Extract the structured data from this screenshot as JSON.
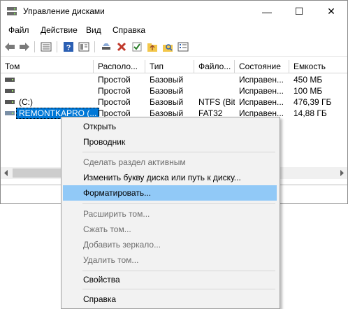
{
  "window": {
    "title": "Управление дисками"
  },
  "window_controls": {
    "minimize": "—",
    "maximize": "☐",
    "close": "✕"
  },
  "menu": [
    "Файл",
    "Действие",
    "Вид",
    "Справка"
  ],
  "toolbar_icons": [
    "back-arrow-icon",
    "forward-arrow-icon",
    "properties-panel-icon",
    "help-icon",
    "details-panel-icon",
    "connect-icon",
    "delete-icon",
    "check-icon",
    "folder-up-icon",
    "search-icon",
    "list-icon"
  ],
  "columns": [
    "Том",
    "Располо...",
    "Тип",
    "Файло...",
    "Состояние",
    "Емкость"
  ],
  "rows": [
    {
      "tom": "",
      "layout": "Простой",
      "type": "Базовый",
      "fs": "",
      "status": "Исправен...",
      "capacity": "450 МБ"
    },
    {
      "tom": "",
      "layout": "Простой",
      "type": "Базовый",
      "fs": "",
      "status": "Исправен...",
      "capacity": "100 МБ"
    },
    {
      "tom": "(C:)",
      "layout": "Простой",
      "type": "Базовый",
      "fs": "NTFS (BitL...",
      "status": "Исправен...",
      "capacity": "476,39 ГБ"
    },
    {
      "tom": "REMONTKAPRO (...",
      "layout": "Простой",
      "type": "Базовый",
      "fs": "FAT32",
      "status": "Исправен...",
      "capacity": "14,88 ГБ"
    }
  ],
  "context_menu": {
    "open": "Открыть",
    "explorer": "Проводник",
    "make_active": "Сделать раздел активным",
    "change_letter": "Изменить букву диска или путь к диску...",
    "format": "Форматировать...",
    "extend": "Расширить том...",
    "shrink": "Сжать том...",
    "add_mirror": "Добавить зеркало...",
    "delete": "Удалить том...",
    "properties": "Свойства",
    "help": "Справка"
  },
  "colors": {
    "selection": "#0078d7",
    "menu_highlight": "#91c9f7",
    "menu_bg": "#f2f2f2"
  }
}
